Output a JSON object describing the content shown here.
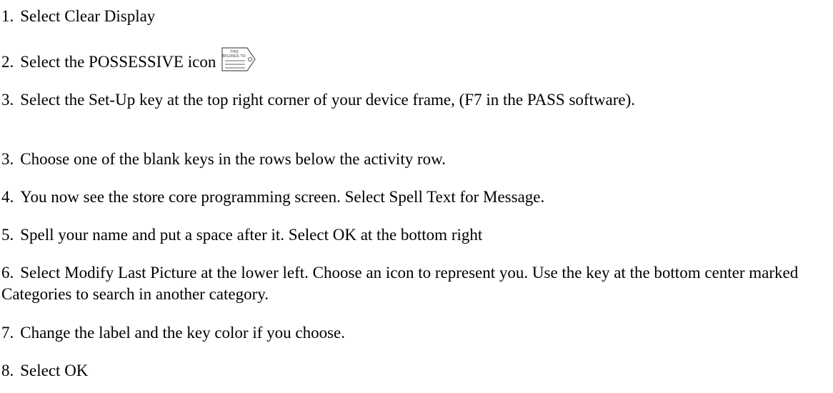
{
  "steps": [
    {
      "number": "1.",
      "text": "Select Clear Display"
    },
    {
      "number": "2.",
      "text": "Select the POSSESSIVE icon",
      "icon": "possessive-tag-icon",
      "icon_text": [
        "THIS",
        "BELONGS TO:"
      ]
    },
    {
      "number": "3.",
      "text": "Select the Set-Up key at the top right corner of your device frame, (F7 in the PASS software)."
    },
    {
      "number": "3.",
      "text": "Choose one of the blank keys in the rows below the activity row."
    },
    {
      "number": "4.",
      "text": "You now see the store core programming screen.  Select Spell Text for Message."
    },
    {
      "number": "5.",
      "text": "Spell your name and put a space after it. Select OK at the bottom right"
    },
    {
      "number": "6.",
      "text": "Select Modify Last Picture at the lower left.  Choose an icon to represent you.  Use the key at the bottom center marked Categories to search in another category."
    },
    {
      "number": "7.",
      "text": "Change the label and the key color if you choose."
    },
    {
      "number": "8.",
      "text": "Select OK"
    }
  ]
}
